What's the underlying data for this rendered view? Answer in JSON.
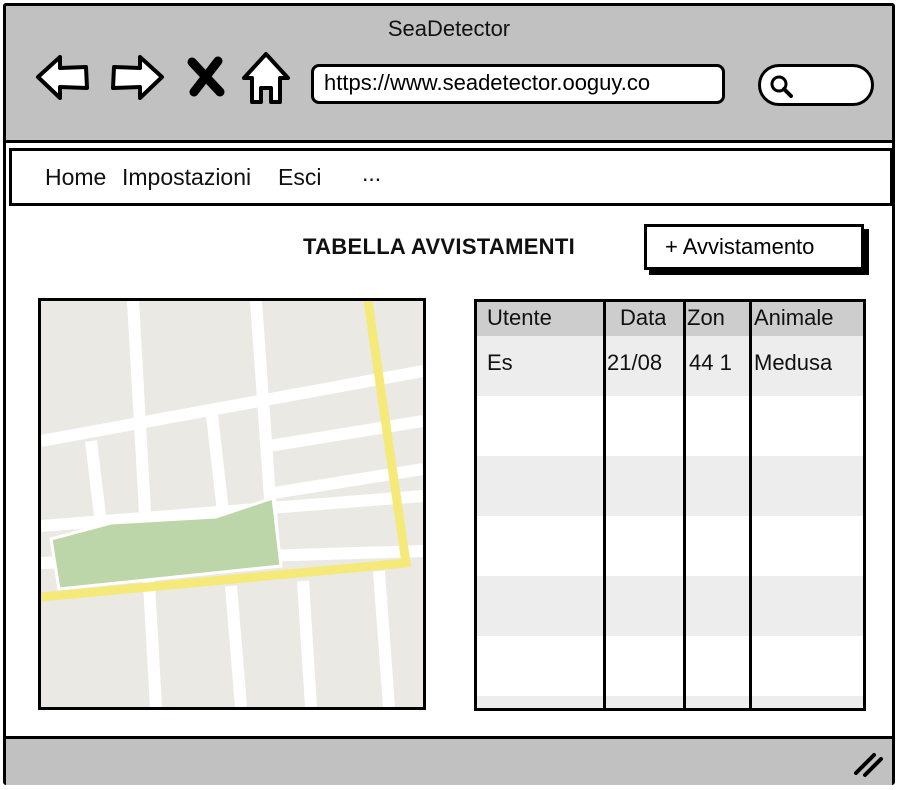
{
  "window": {
    "title": "SeaDetector"
  },
  "browser": {
    "url": "https://www.seadetector.ooguy.co",
    "icons": [
      "back-icon",
      "forward-icon",
      "stop-icon",
      "home-icon",
      "search-icon"
    ]
  },
  "menu": {
    "items": [
      "Home",
      "Impostazioni",
      "Esci",
      "..."
    ]
  },
  "main": {
    "heading": "TABELLA AVVISTAMENTI",
    "add_button": "+ Avvistamento"
  },
  "table": {
    "headers": [
      "Utente",
      "Data",
      "Zon",
      "Animale"
    ],
    "rows": [
      [
        "Es",
        "21/08",
        "44 1",
        "Medusa"
      ]
    ]
  },
  "colors": {
    "chrome": "#c1c1c1",
    "map_road_major": "#f5e97a",
    "map_park": "#bdd6a9",
    "map_land": "#ebe9e3",
    "table_header": "#cdcdcd",
    "table_alt_row": "#ededed"
  }
}
